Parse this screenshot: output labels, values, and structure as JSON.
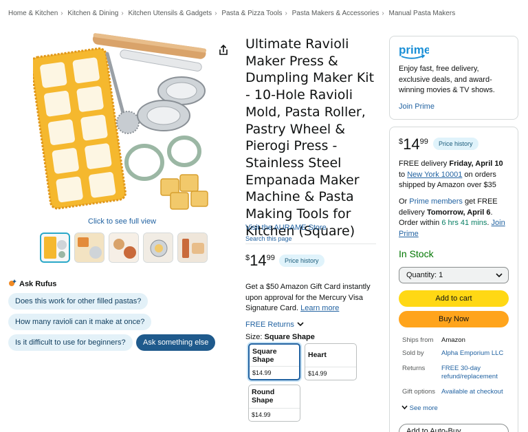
{
  "breadcrumb": [
    "Home & Kitchen",
    "Kitchen & Dining",
    "Kitchen Utensils & Gadgets",
    "Pasta & Pizza Tools",
    "Pasta Makers & Accessories",
    "Manual Pasta Makers"
  ],
  "gallery": {
    "full_view": "Click to see full view",
    "thumbnails": [
      "thumb-product",
      "thumb-ravioli",
      "thumb-usage",
      "thumb-dumpling",
      "thumb-tools"
    ]
  },
  "rufus": {
    "title": "Ask Rufus",
    "questions": [
      "Does this work for other filled pastas?",
      "How many ravioli can it make at once?",
      "Is it difficult to use for beginners?"
    ],
    "ask_else": "Ask something else"
  },
  "product": {
    "title": "Ultimate Ravioli Maker Press & Dumpling Maker Kit - 10-Hole Ravioli Mold, Pasta Roller, Pastry Wheel & Pierogi Press - Stainless Steel Empanada Maker Machine & Pasta Making Tools for Kitchen (Square)",
    "store": "Visit the AURAME Store",
    "search_page": "Search this page",
    "price": {
      "symbol": "$",
      "whole": "14",
      "fraction": "99"
    },
    "price_history": "Price history",
    "gift_card": "Get a $50 Amazon Gift Card instantly upon approval for the Mercury Visa Signature Card.",
    "learn_more": "Learn more",
    "free_returns": "FREE Returns",
    "size_label": "Size:",
    "size_value": "Square Shape",
    "sizes": [
      {
        "name": "Square Shape",
        "price": "$14.99",
        "selected": true
      },
      {
        "name": "Heart",
        "price": "$14.99",
        "selected": false
      },
      {
        "name": "Round Shape",
        "price": "$14.99",
        "selected": false
      }
    ]
  },
  "prime_box": {
    "logo": "prime",
    "text": "Enjoy fast, free delivery, exclusive deals, and award-winning movies & TV shows.",
    "join": "Join Prime"
  },
  "buy_box": {
    "price": {
      "symbol": "$",
      "whole": "14",
      "fraction": "99"
    },
    "price_history": "Price history",
    "delivery_pre": "FREE delivery ",
    "delivery_date": "Friday, April 10",
    "delivery_to": " to ",
    "location": "New York 10001",
    "delivery_post": " on orders shipped by Amazon over $35",
    "fast_or": "Or ",
    "prime_members": "Prime members",
    "fast_mid": " get FREE delivery ",
    "fast_date": "Tomorrow, April 6",
    "order_within": ". Order within ",
    "countdown": "6 hrs 41 mins",
    "join_prime": "Join Prime",
    "stock": "In Stock",
    "quantity": "Quantity: 1",
    "add_to_cart": "Add to cart",
    "buy_now": "Buy Now",
    "details": [
      {
        "key": "Ships from",
        "value": "Amazon"
      },
      {
        "key": "Sold by",
        "value": "Alpha Emporium LLC"
      },
      {
        "key": "Returns",
        "value": "FREE 30-day refund/replacement"
      },
      {
        "key": "Gift options",
        "value": "Available at checkout"
      }
    ],
    "see_more": "See more",
    "auto_buy": "Add to Auto-Buy"
  },
  "colors": {
    "link": "#2162a1",
    "cart": "#ffd814",
    "buy": "#ffa41c",
    "stock": "#007600",
    "mold": "#f5b82e"
  }
}
